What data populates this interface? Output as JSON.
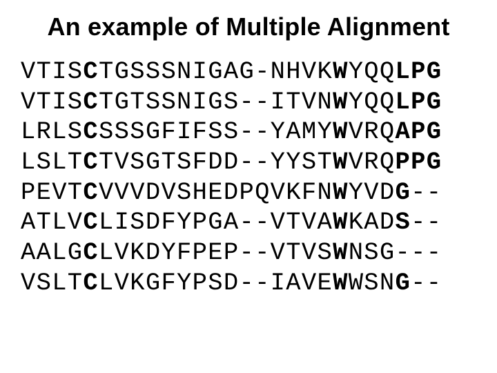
{
  "title": "An example of Multiple Alignment",
  "alignment": {
    "bold_columns": [
      4,
      20,
      24,
      25,
      26,
      27
    ],
    "sequences": [
      "VTISCTGSSSNIGAG-NHVKWYQQLPG",
      "VTISCTGTSSNIGS--ITVNWYQQLPG",
      "LRLSCSSSGFIFSS--YAMYWVRQAPG",
      "LSLTCTVSGTSFDD--YYSTWVRQPPG",
      "PEVTCVVVDVSHEDPQVKFNWYVDG--",
      "ATLVCLISDFYPGA--VTVAWKADS--",
      "AALGCLVKDYFPEP--VTVSWNSG---",
      "VSLTCLVKGFYPSD--IAVEWWSNG--"
    ]
  }
}
